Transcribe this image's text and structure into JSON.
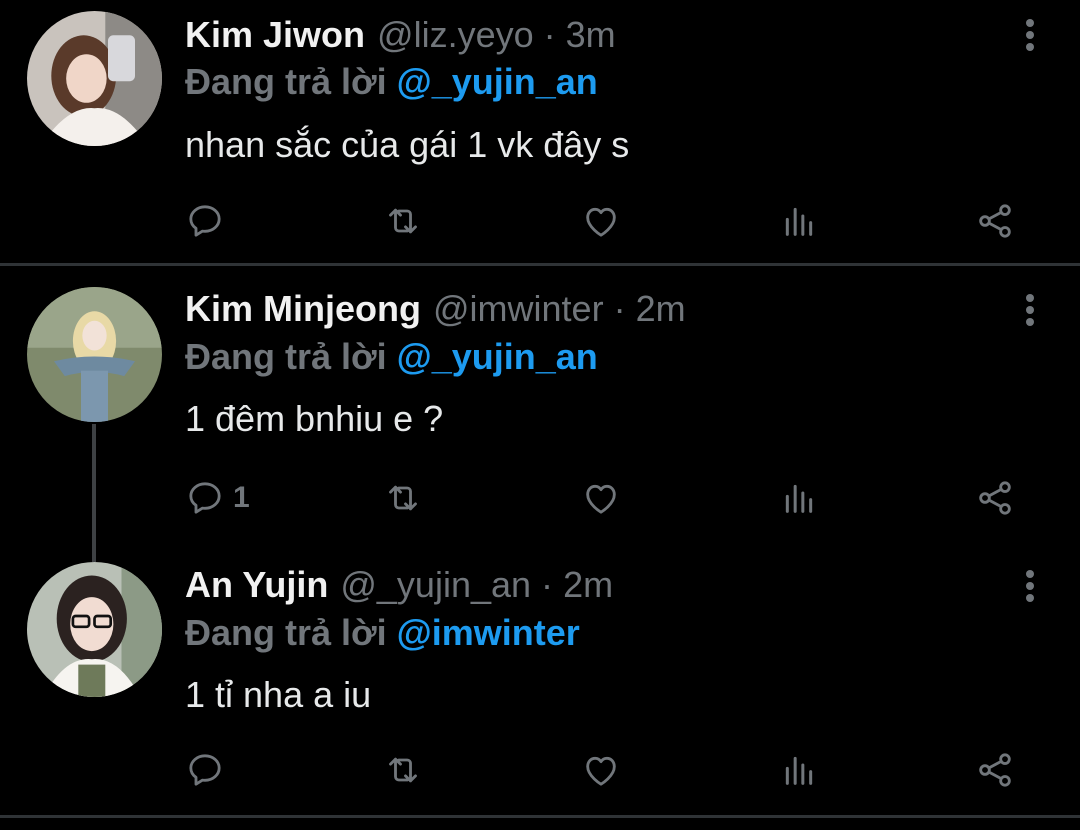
{
  "tweets": [
    {
      "name": "Kim Jiwon",
      "handle": "@liz.yeyo",
      "separator": "·",
      "time": "3m",
      "reply_label": "Đang trả lời",
      "reply_to": "@_yujin_an",
      "text": "nhan sắc của gái 1 vk đây s",
      "reply_count": ""
    },
    {
      "name": "Kim Minjeong",
      "handle": "@imwinter",
      "separator": "·",
      "time": "2m",
      "reply_label": "Đang trả lời",
      "reply_to": "@_yujin_an",
      "text": "1 đêm bnhiu e ?",
      "reply_count": "1"
    },
    {
      "name": "An Yujin",
      "handle": "@_yujin_an",
      "separator": "·",
      "time": "2m",
      "reply_label": "Đang trả lời",
      "reply_to": "@imwinter",
      "text": "1 tỉ nha a iu",
      "reply_count": ""
    }
  ],
  "colors": {
    "background": "#000000",
    "text": "#e7e9ea",
    "muted": "#71767b",
    "accent": "#1d9bf0",
    "divider": "#2f3336"
  },
  "icons": [
    "more-icon",
    "reply-icon",
    "retweet-icon",
    "like-icon",
    "stats-icon",
    "share-icon"
  ]
}
